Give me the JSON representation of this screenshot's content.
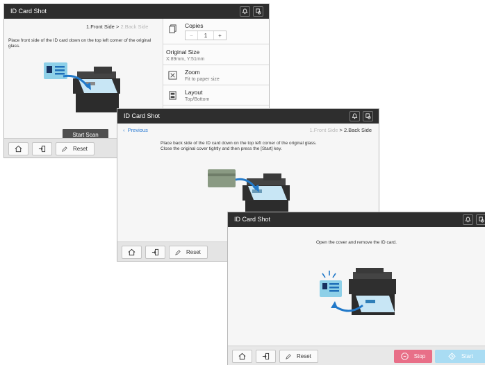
{
  "screen1": {
    "title": "ID Card Shot",
    "step_active": "1.Front Side",
    "step_sep": ">",
    "step_inactive": "2.Back Side",
    "instruction": "Place front side of the ID card down on the top left corner of the original glass.",
    "start_scan": "Start Scan",
    "reset": "Reset",
    "copies_label": "Copies",
    "copies_value": "1",
    "copies_minus": "−",
    "copies_plus": "+",
    "original_size_label": "Original Size",
    "original_size_value": "X:89mm, Y:51mm",
    "zoom_label": "Zoom",
    "zoom_value": "Fit to paper size",
    "layout_label": "Layout",
    "layout_value": "Top/Bottom"
  },
  "screen2": {
    "title": "ID Card Shot",
    "previous": "Previous",
    "step_inactive": "1.Front Side",
    "step_sep": ">",
    "step_active": "2.Back Side",
    "instruction_line1": "Place back side of the ID card down on the top left corner of the original glass.",
    "instruction_line2": "Close the original cover tightly and then press the [Start] key.",
    "reset": "Reset"
  },
  "screen3": {
    "title": "ID Card Shot",
    "instruction": "Open the cover and remove the ID card.",
    "reset": "Reset",
    "stop": "Stop",
    "start": "Start"
  },
  "icons": [
    "bell-icon",
    "user-switch-icon",
    "home-icon",
    "login-icon",
    "reset-pencil-icon",
    "copies-icon",
    "zoom-icon",
    "layout-icon",
    "chevron-left-icon",
    "stop-icon",
    "start-icon"
  ],
  "colors": {
    "titlebar": "#2e2e2e",
    "accent_blue": "#2a7bd3",
    "stop": "#e86f88",
    "start": "#a9dcf3",
    "card": "#8ed0e8"
  }
}
